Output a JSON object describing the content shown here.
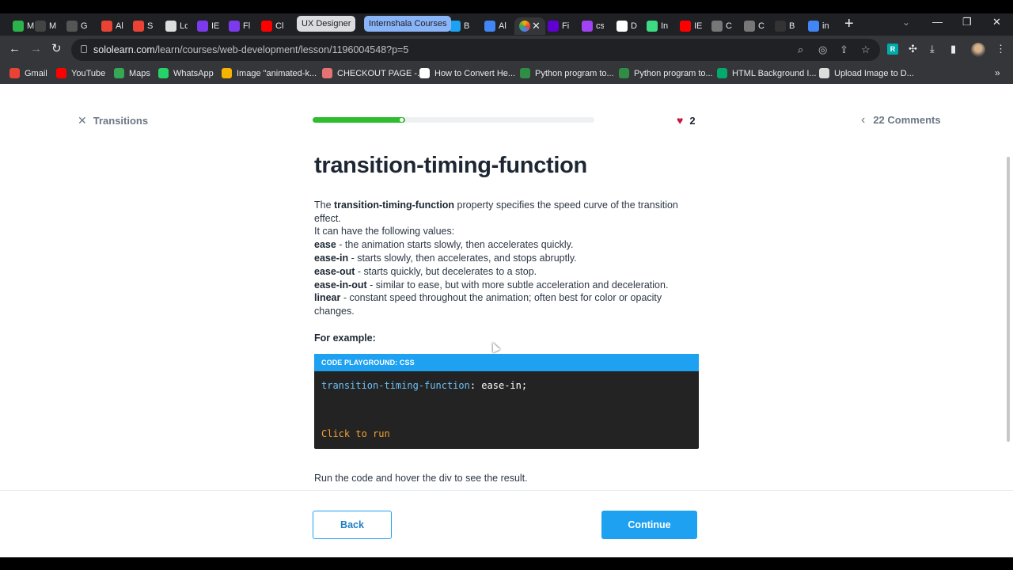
{
  "browser": {
    "tabs": [
      {
        "label": "M",
        "color": "#2bb24c"
      },
      {
        "label": "M",
        "color": "#444444"
      },
      {
        "label": "G",
        "color": "#555555"
      },
      {
        "label": "Al",
        "color": "#ea4335"
      },
      {
        "label": "S",
        "color": "#ea4335"
      },
      {
        "label": "Lc",
        "color": "#dddddd"
      },
      {
        "label": "IE",
        "color": "#7c3aed"
      },
      {
        "label": "Fl",
        "color": "#7c3aed"
      },
      {
        "label": "Cl",
        "color": "#ff0000"
      },
      {
        "label": "B",
        "color": "#1da1f2"
      },
      {
        "label": "Al",
        "color": "#4285f4"
      },
      {
        "label": "Fi",
        "color": "#6001d2"
      },
      {
        "label": "cs",
        "color": "#a142f4"
      },
      {
        "label": "D",
        "color": "#ffffff"
      },
      {
        "label": "In",
        "color": "#3ddc84"
      },
      {
        "label": "IE",
        "color": "#ff0000"
      },
      {
        "label": "C",
        "color": "#777777"
      },
      {
        "label": "C",
        "color": "#777777"
      },
      {
        "label": "B",
        "color": "#333333"
      },
      {
        "label": "in",
        "color": "#4285f4"
      }
    ],
    "active_tab_close": "✕",
    "groups": {
      "ux": "UX Designer",
      "intern": "Internshala Courses"
    },
    "url_host": "sololearn.com",
    "url_path": "/learn/courses/web-development/lesson/1196004548?p=5",
    "bookmarks": [
      {
        "label": "Gmail",
        "color": "#ea4335"
      },
      {
        "label": "YouTube",
        "color": "#ff0000"
      },
      {
        "label": "Maps",
        "color": "#34a853"
      },
      {
        "label": "WhatsApp",
        "color": "#25d366"
      },
      {
        "label": "Image \"animated-k...",
        "color": "#f4b400"
      },
      {
        "label": "CHECKOUT PAGE -...",
        "color": "#e57373"
      },
      {
        "label": "How to Convert He...",
        "color": "#ffffff"
      },
      {
        "label": "Python program to...",
        "color": "#2f8d46"
      },
      {
        "label": "Python program to...",
        "color": "#2f8d46"
      },
      {
        "label": "HTML Background I...",
        "color": "#04aa6d"
      },
      {
        "label": "Upload Image to D...",
        "color": "#dddddd"
      }
    ]
  },
  "lesson": {
    "close_label": "Transitions",
    "progress": 0.33,
    "hearts": "2",
    "comments": "22 Comments",
    "title": "transition-timing-function",
    "intro_prefix": "The ",
    "intro_bold": "transition-timing-function",
    "intro_suffix": " property specifies the speed curve of the transition effect.",
    "values_intro": "It can have the following values:",
    "values": [
      {
        "term": "ease",
        "desc": " - the animation starts slowly, then accelerates quickly."
      },
      {
        "term": "ease-in",
        "desc": " - starts slowly, then accelerates, and stops abruptly."
      },
      {
        "term": "ease-out",
        "desc": " - starts quickly, but decelerates to a stop."
      },
      {
        "term": "ease-in-out",
        "desc": " - similar to ease, but with more subtle acceleration and deceleration."
      },
      {
        "term": "linear",
        "desc": " - constant speed throughout the animation; often best for color or opacity changes."
      }
    ],
    "example_label": "For example:",
    "playground": {
      "header": "CODE PLAYGROUND: CSS",
      "code_prop": "transition-timing-function",
      "code_rest": ": ease-in;",
      "run_label": "Click to run"
    },
    "after_text": "Run the code and hover the div to see the result.",
    "back_label": "Back",
    "continue_label": "Continue"
  }
}
